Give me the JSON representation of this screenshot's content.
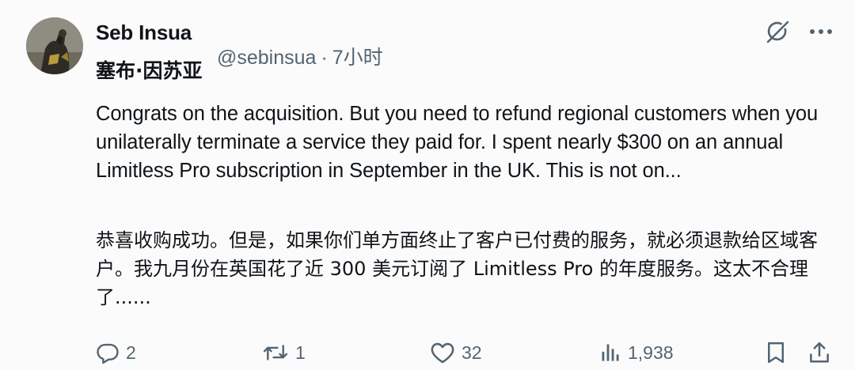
{
  "author": {
    "display_name": "Seb Insua",
    "translated_name": "塞布·因苏亚",
    "handle": "@sebinsua",
    "separator": "·",
    "time": "7小时"
  },
  "post": {
    "text_en": "Congrats on the acquisition. But you need to refund  regional customers when you unilaterally terminate a service they paid for. I spent nearly $300 on an annual Limitless Pro subscription in September in the UK. This is not on...",
    "text_zh": "恭喜收购成功。但是，如果你们单方面终止了客户已付费的服务，就必须退款给区域客户。我九月份在英国花了近 300 美元订阅了 Limitless Pro 的年度服务。这太不合理了......"
  },
  "header_icons": [
    "grok-icon",
    "more-icon"
  ],
  "metrics": {
    "replies": "2",
    "reposts": "1",
    "likes": "32",
    "views": "1,938"
  },
  "colors": {
    "text": "#0f1419",
    "secondary": "#536471",
    "background": "#fbfbfb"
  }
}
